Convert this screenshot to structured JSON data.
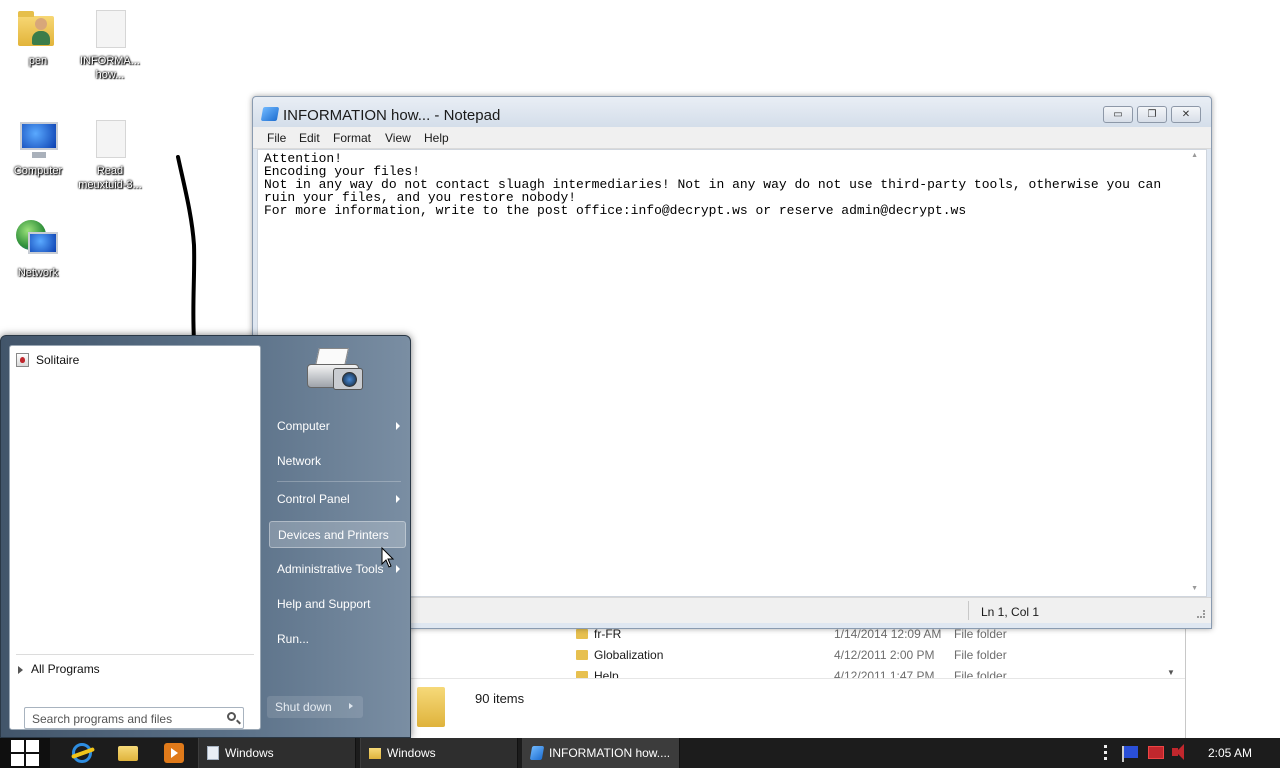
{
  "desktop": {
    "icons": [
      {
        "label": "pen"
      },
      {
        "label": "INFORMA... how..."
      },
      {
        "label": "Computer"
      },
      {
        "label": "Read meuxtuid-3..."
      },
      {
        "label": "Network"
      }
    ]
  },
  "explorer": {
    "rows": [
      {
        "name": "fr-FR",
        "date": "1/14/2014 12:09 AM",
        "type": "File folder"
      },
      {
        "name": "Globalization",
        "date": "4/12/2011 2:00 PM",
        "type": "File folder"
      },
      {
        "name": "Help",
        "date": "4/12/2011 1:47 PM",
        "type": "File folder"
      }
    ],
    "item_count": "90 items"
  },
  "notepad": {
    "title": "INFORMATION how... - Notepad",
    "buttons": {
      "minimize": "▭",
      "restore": "❐",
      "close": "✕"
    },
    "menu": [
      "File",
      "Edit",
      "Format",
      "View",
      "Help"
    ],
    "text": "Attention!\nEncoding your files!\nNot in any way do not contact sluagh intermediaries! Not in any way do not use third-party tools, otherwise you can\nruin your files, and you restore nobody!\nFor more information, write to the post office:info@decrypt.ws or reserve admin@decrypt.ws",
    "status_position": "Ln 1, Col 1"
  },
  "start_menu": {
    "programs": [
      {
        "label": "Solitaire",
        "icon": "solitaire-icon"
      }
    ],
    "all_programs": "All Programs",
    "search_placeholder": "Search programs and files",
    "right_items": [
      {
        "label": "Computer",
        "submenu": true
      },
      {
        "label": "Network",
        "submenu": false
      },
      {
        "label": "Control Panel",
        "submenu": true
      },
      {
        "label": "Devices and Printers",
        "submenu": false,
        "highlighted": true
      },
      {
        "label": "Administrative Tools",
        "submenu": true
      },
      {
        "label": "Help and Support",
        "submenu": false
      },
      {
        "label": "Run...",
        "submenu": false
      }
    ],
    "shutdown": "Shut down"
  },
  "taskbar": {
    "tasks": [
      {
        "label": "Windows",
        "icon": "document-icon"
      },
      {
        "label": "Windows",
        "icon": "folder-icon"
      },
      {
        "label": "INFORMATION how....",
        "icon": "notepad-icon"
      }
    ],
    "clock": "2:05 AM"
  }
}
